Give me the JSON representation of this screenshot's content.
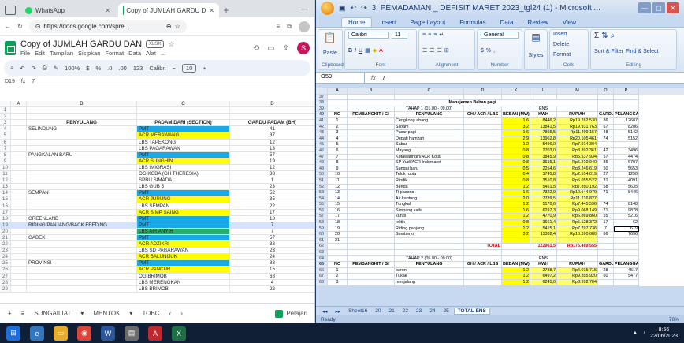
{
  "chrome": {
    "tab1_title": "WhatsApp",
    "tab2_title": "Copy of JUMLAH GARDU D",
    "url": "https://docs.google.com/spre...",
    "doc_title": "Copy of JUMLAH GARDU DAN",
    "file_badge": "XLSX",
    "menu": [
      "File",
      "Edit",
      "Tampilan",
      "Sisipkan",
      "Format",
      "Data",
      "Alat",
      "..."
    ],
    "toolbar_zoom": "100%",
    "toolbar_currency": "$",
    "toolbar_percent": "%",
    "toolbar_dec": ".0",
    "toolbar_dec2": ".00",
    "toolbar_123": "123",
    "toolbar_font": "Calibri",
    "toolbar_fontsize": "10",
    "cell_ref": "D19",
    "formula": "7",
    "profile_initial": "S",
    "col_headers": [
      "",
      "A",
      "B",
      "C",
      "D"
    ],
    "rows": [
      {
        "n": "1",
        "b": "",
        "c": "",
        "d": ""
      },
      {
        "n": "2",
        "b": "",
        "c": "",
        "d": ""
      },
      {
        "n": "3",
        "b": "PENYULANG",
        "c": "PADAM DARI (SECTION)",
        "d": "GARDU PADAM (BH)",
        "hdr": true
      },
      {
        "n": "4",
        "b": "SELINDUNG",
        "c": "PMT",
        "d": "41",
        "cbg": "blue"
      },
      {
        "n": "5",
        "b": "",
        "c": "ACR MERAWANG",
        "d": "37",
        "cbg": "yellow"
      },
      {
        "n": "6",
        "b": "",
        "c": "LBS TAPEKONG",
        "d": "12"
      },
      {
        "n": "7",
        "b": "",
        "c": "LBS PAGARAWAN",
        "d": "13"
      },
      {
        "n": "8",
        "b": "PANGKALAN BARU",
        "c": "PMT",
        "d": "57",
        "cbg": "blue"
      },
      {
        "n": "9",
        "b": "",
        "c": "ACR SUNGHIN",
        "d": "19",
        "cbg": "yellow"
      },
      {
        "n": "10",
        "b": "",
        "c": "LBS IMIGRASI",
        "d": "12"
      },
      {
        "n": "11",
        "b": "",
        "c": "OG KOBA (GH THERESIA)",
        "d": "38"
      },
      {
        "n": "12",
        "b": "",
        "c": "SPBU SIMADA",
        "d": "1"
      },
      {
        "n": "13",
        "b": "",
        "c": "LBS GUB 5",
        "d": "23"
      },
      {
        "n": "14",
        "b": "SEMPAN",
        "c": "PMT",
        "d": "52",
        "cbg": "blue"
      },
      {
        "n": "15",
        "b": "",
        "c": "ACR JURUNG",
        "d": "35",
        "cbg": "yellow"
      },
      {
        "n": "16",
        "b": "",
        "c": "LBS SEMPAN",
        "d": "22"
      },
      {
        "n": "17",
        "b": "",
        "c": "ACR SIMP SAING",
        "d": "17",
        "cbg": "yellow"
      },
      {
        "n": "18",
        "b": "GREENLAND",
        "c": "PMT",
        "d": "18",
        "cbg": "blue"
      },
      {
        "n": "19",
        "b": "RIDING PANJANG/BACK FEEDING",
        "c": "PMT",
        "d": "7",
        "cbg": "blue",
        "sel": true
      },
      {
        "n": "20",
        "b": "",
        "c": "LBS AIR ANYIR",
        "d": "7",
        "cbg": "green"
      },
      {
        "n": "21",
        "b": "GABEK",
        "c": "PMT",
        "d": "57",
        "cbg": "blue"
      },
      {
        "n": "22",
        "b": "",
        "c": "ACR ADZIKRI",
        "d": "33",
        "cbg": "yellow"
      },
      {
        "n": "23",
        "b": "",
        "c": "LBS SD PAGARAWAN",
        "d": "23"
      },
      {
        "n": "24",
        "b": "",
        "c": "ACR BALUNIJUK",
        "d": "24",
        "cbg": "yellow"
      },
      {
        "n": "25",
        "b": "PROVINSI",
        "c": "PMT",
        "d": "83",
        "cbg": "blue"
      },
      {
        "n": "26",
        "b": "",
        "c": "ACR PANCUR",
        "d": "15",
        "cbg": "yellow"
      },
      {
        "n": "27",
        "b": "",
        "c": "OG BRIMOB",
        "d": "68"
      },
      {
        "n": "28",
        "b": "",
        "c": "LBS MERENGKAN",
        "d": "4"
      },
      {
        "n": "29",
        "b": "",
        "c": "LBS BRIMOB",
        "d": "22"
      }
    ],
    "sheet_tabs": [
      "SUNGAILIAT",
      "MENTOK",
      "TOBC"
    ],
    "pelajari": "Pelajari"
  },
  "excel": {
    "title": "3. PEMADAMAN _ DEFISIT MARET 2023_tgl24 (1) - Microsoft ...",
    "ribbon_tabs": [
      "Home",
      "Insert",
      "Page Layout",
      "Formulas",
      "Data",
      "Review",
      "View"
    ],
    "font_name": "Calibri",
    "font_size": "11",
    "number_format": "General",
    "paste": "Paste",
    "styles": "Styles",
    "insert": "Insert",
    "delete": "Delete",
    "format": "Format",
    "sort_filter": "Sort & Filter",
    "find_select": "Find & Select",
    "group_clipboard": "Clipboard",
    "group_font": "Font",
    "group_alignment": "Alignment",
    "group_number": "Number",
    "group_cells": "Cells",
    "group_editing": "Editing",
    "name_box": "O59",
    "formula_value": "7",
    "col_headers": [
      "",
      "A",
      "B",
      "C",
      "D",
      "K",
      "L",
      "M",
      "O",
      "P"
    ],
    "section_title": "Manajemen Beban pagi",
    "tahap1": "TAHAP 1 (01.00 - 09.00)",
    "tahap2": "TAHAP 2 (05.00 - 09.00)",
    "hdr": {
      "no": "NO",
      "pembangkit": "PEMBANGKIT / GI",
      "penyulang": "PENYULANG",
      "gh": "GH / ACR / LBS",
      "beban": "BEBAN (MW)",
      "kwh": "KWH",
      "ens": "ENS",
      "rupiah": "RUPIAH",
      "gardu": "GARDU",
      "pelanggan": "PELANGGAN"
    },
    "rows1": [
      {
        "n": "1",
        "p": "Cengkong abang",
        "mw": "1,6",
        "kwh": "8446,2",
        "rp": "Rp19.282.530",
        "g": "86",
        "pl": "12687"
      },
      {
        "n": "2",
        "p": "Siloam",
        "mw": "3,2",
        "kwh": "13841,5",
        "rp": "Rp19.931.763",
        "g": "67",
        "pl": "8206"
      },
      {
        "n": "3",
        "p": "Pasar pagi",
        "mw": "1,6",
        "kwh": "7865,5",
        "rp": "Rp11.499.157",
        "g": "48",
        "pl": "5142"
      },
      {
        "n": "4",
        "p": "Depati hamzah",
        "mw": "2,9",
        "kwh": "13962,8",
        "rp": "Rp20.105.461",
        "g": "74",
        "pl": "5152"
      },
      {
        "n": "5",
        "p": "Sabar",
        "mw": "1,2",
        "kwh": "5496,0",
        "rp": "Rp7.914.304",
        "g": "",
        "pl": ""
      },
      {
        "n": "6",
        "p": "Mayang",
        "mw": "0,8",
        "kwh": "2703,0",
        "rp": "Rp3.892.361",
        "g": "42",
        "pl": "3496"
      },
      {
        "n": "7",
        "p": "Kotawaringin/ACR Kota",
        "mw": "0,8",
        "kwh": "3845,9",
        "rp": "Rp5.537.934",
        "g": "57",
        "pl": "4474"
      },
      {
        "n": "8",
        "p": "SP Yudi/ACR Indomaret",
        "mw": "0,8",
        "kwh": "3615,1",
        "rp": "Rp5.210.040",
        "g": "85",
        "pl": "6707"
      },
      {
        "n": "9",
        "p": "Sungai baru",
        "mw": "0,5",
        "kwh": "2254,6",
        "rp": "Rp3.246.619",
        "g": "50",
        "pl": "5653"
      },
      {
        "n": "10",
        "p": "Teluk rubia",
        "mw": "0,4",
        "kwh": "1745,8",
        "rp": "Rp2.514.019",
        "g": "27",
        "pl": "1250"
      },
      {
        "n": "11",
        "p": "Rindik",
        "mw": "0,8",
        "kwh": "3510,8",
        "rp": "Rp5.055.522",
        "g": "31",
        "pl": "4091"
      },
      {
        "n": "12",
        "p": "Beriga",
        "mw": "1,2",
        "kwh": "5451,5",
        "rp": "Rp7.850.192",
        "g": "58",
        "pl": "5635"
      },
      {
        "n": "13",
        "p": "Ti pasona",
        "mw": "1,6",
        "kwh": "7322,9",
        "rp": "Rp10.544.979",
        "g": "71",
        "pl": "8446"
      },
      {
        "n": "14",
        "p": "Air kantung",
        "mw": "2,0",
        "kwh": "7789,5",
        "rp": "Rp11.216.827",
        "g": "",
        "pl": ""
      },
      {
        "n": "15",
        "p": "Tungkal",
        "mw": "1,2",
        "kwh": "5170,6",
        "rp": "Rp7.445.596",
        "g": "74",
        "pl": "8148"
      },
      {
        "n": "16",
        "p": "Simpang kaila",
        "mw": "1,6",
        "kwh": "6297,3",
        "rp": "Rp9.068.149",
        "g": "71",
        "pl": "9878"
      },
      {
        "n": "17",
        "p": "kundi",
        "mw": "1,2",
        "kwh": "4770,9",
        "rp": "Rp6.869.860",
        "g": "55",
        "pl": "5216"
      },
      {
        "n": "18",
        "p": "jelitik",
        "mw": "0,8",
        "kwh": "3661,4",
        "rp": "Rp5.128.372",
        "g": "17",
        "pl": "62"
      },
      {
        "n": "19",
        "p": "Riding panjang",
        "mw": "1,2",
        "kwh": "5415,1",
        "rp": "Rp7.797.736",
        "g": "7",
        "pl": "619",
        "sel": true
      },
      {
        "n": "20",
        "p": "Sumberjo",
        "mw": "3,2",
        "kwh": "11382,4",
        "rp": "Rp16.390.680",
        "g": "66",
        "pl": "7696"
      },
      {
        "n": "21",
        "p": "",
        "mw": "",
        "kwh": "",
        "rp": "",
        "g": "",
        "pl": ""
      }
    ],
    "total_label": "TOTAL",
    "total_kwh": "122961,5",
    "total_rp": "Rp176.489.555",
    "rows2": [
      {
        "n": "1",
        "p": "baron",
        "mw": "1,2",
        "kwh": "2788,7",
        "rp": "Rp4.015.715",
        "g": "28",
        "pl": "4517"
      },
      {
        "n": "2",
        "p": "Tukak",
        "mw": "1,2",
        "kwh": "6497,2",
        "rp": "Rp9.355.920",
        "g": "60",
        "pl": "5477"
      },
      {
        "n": "3",
        "p": "menjalang",
        "mw": "1,2",
        "kwh": "6245,0",
        "rp": "Rp8.992.784",
        "g": "",
        "pl": ""
      }
    ],
    "sheet_tabs": [
      "Sheet16",
      "20",
      "21",
      "22",
      "23",
      "24",
      "25",
      "TOTAL ENS"
    ],
    "active_tab": "TOTAL ENS",
    "status": "Ready",
    "zoom": "70%"
  },
  "taskbar": {
    "time": "8:56",
    "date": "22/06/2023"
  }
}
